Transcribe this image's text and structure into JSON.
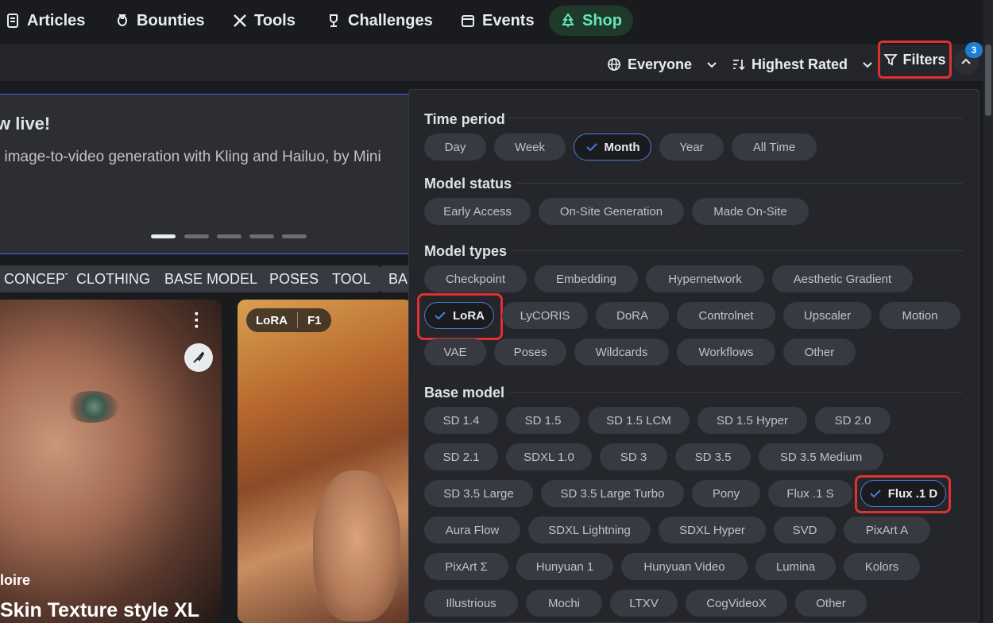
{
  "nav": {
    "items": [
      {
        "label": "Articles",
        "icon": "article-icon"
      },
      {
        "label": "Bounties",
        "icon": "moneybag-icon"
      },
      {
        "label": "Tools",
        "icon": "tools-icon"
      },
      {
        "label": "Challenges",
        "icon": "trophy-icon"
      },
      {
        "label": "Events",
        "icon": "calendar-icon"
      },
      {
        "label": "Shop",
        "icon": "tree-icon"
      }
    ]
  },
  "toolbar": {
    "audience": "Everyone",
    "sort": "Highest Rated",
    "filters_label": "Filters",
    "filters_count": "3"
  },
  "banner": {
    "title": "w live!",
    "text": "l image-to-video generation with Kling and Hailuo, by Mini"
  },
  "tags": [
    "CONCEPT",
    "CLOTHING",
    "BASE MODEL",
    "POSES",
    "TOOL",
    "BAC"
  ],
  "cards": [
    {
      "author": "loire",
      "title": "Skin Texture style XL"
    },
    {
      "badge_type": "LoRA",
      "badge_base": "F1"
    }
  ],
  "filters": {
    "time_period": {
      "title": "Time period",
      "options": [
        "Day",
        "Week",
        "Month",
        "Year",
        "All Time"
      ],
      "selected": "Month"
    },
    "model_status": {
      "title": "Model status",
      "options": [
        "Early Access",
        "On-Site Generation",
        "Made On-Site"
      ]
    },
    "model_types": {
      "title": "Model types",
      "options": [
        "Checkpoint",
        "Embedding",
        "Hypernetwork",
        "Aesthetic Gradient",
        "LoRA",
        "LyCORIS",
        "DoRA",
        "Controlnet",
        "Upscaler",
        "Motion",
        "VAE",
        "Poses",
        "Wildcards",
        "Workflows",
        "Other"
      ],
      "selected": "LoRA"
    },
    "base_model": {
      "title": "Base model",
      "options": [
        "SD 1.4",
        "SD 1.5",
        "SD 1.5 LCM",
        "SD 1.5 Hyper",
        "SD 2.0",
        "SD 2.1",
        "SDXL 1.0",
        "SD 3",
        "SD 3.5",
        "SD 3.5 Medium",
        "SD 3.5 Large",
        "SD 3.5 Large Turbo",
        "Pony",
        "Flux .1 S",
        "Flux .1 D",
        "Aura Flow",
        "SDXL Lightning",
        "SDXL Hyper",
        "SVD",
        "PixArt A",
        "PixArt Σ",
        "Hunyuan 1",
        "Hunyuan Video",
        "Lumina",
        "Kolors",
        "Illustrious",
        "Mochi",
        "LTXV",
        "CogVideoX",
        "Other"
      ],
      "selected": "Flux .1 D"
    }
  },
  "colors": {
    "accent": "#4d7bd9",
    "highlight": "#e03131",
    "badge": "#1c7ed6",
    "shop": "#63e6be"
  }
}
